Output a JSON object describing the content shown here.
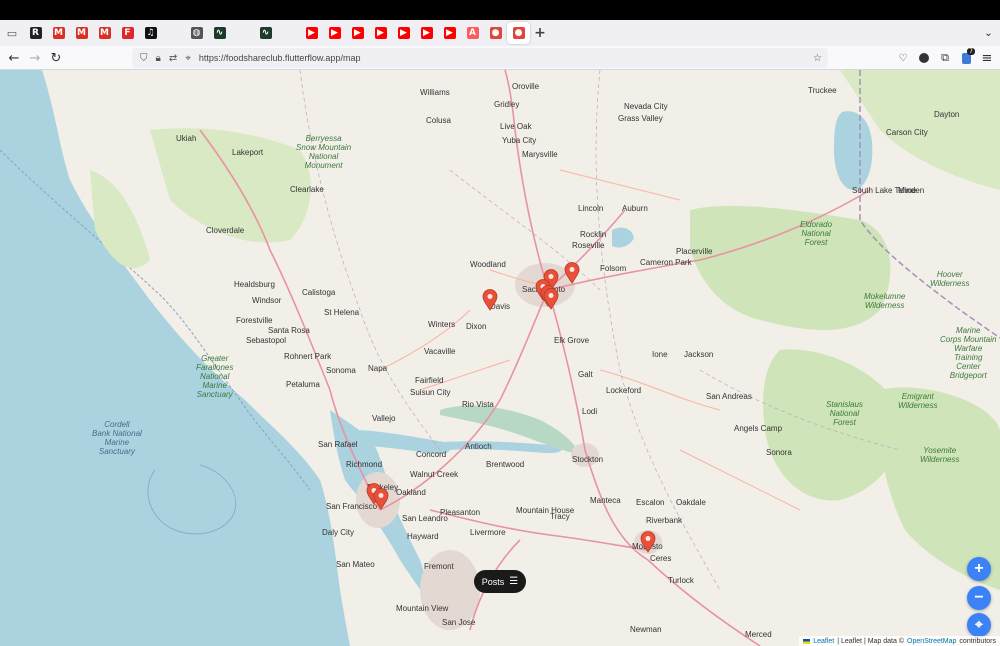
{
  "browser": {
    "url": "https://foodshareclub.flutterflow.app/map",
    "tabs": [
      {
        "icon": "r-icon",
        "color": "#222",
        "glyph": "R"
      },
      {
        "icon": "gmail-icon",
        "color": "#d93025",
        "glyph": "M"
      },
      {
        "icon": "gmail-icon",
        "color": "#d93025",
        "glyph": "M"
      },
      {
        "icon": "gmail-icon",
        "color": "#d93025",
        "glyph": "M"
      },
      {
        "icon": "flipboard-icon",
        "color": "#e12828",
        "glyph": "F"
      },
      {
        "icon": "spotify-icon",
        "color": "#111",
        "glyph": "♫"
      },
      {
        "icon": "blank-icon",
        "color": "#f0f0f4",
        "glyph": ""
      },
      {
        "icon": "globe-icon",
        "color": "#555",
        "glyph": "◍"
      },
      {
        "icon": "chart-icon",
        "color": "#1d3b2a",
        "glyph": "∿"
      },
      {
        "icon": "blank-icon",
        "color": "#f0f0f4",
        "glyph": ""
      },
      {
        "icon": "chart-icon",
        "color": "#1d3b2a",
        "glyph": "∿"
      },
      {
        "icon": "blank-icon",
        "color": "#f0f0f4",
        "glyph": ""
      },
      {
        "icon": "youtube-icon",
        "color": "#ff0000",
        "glyph": "▶"
      },
      {
        "icon": "youtube-icon",
        "color": "#ff0000",
        "glyph": "▶"
      },
      {
        "icon": "youtube-icon",
        "color": "#ff0000",
        "glyph": "▶"
      },
      {
        "icon": "youtube-icon",
        "color": "#ff0000",
        "glyph": "▶"
      },
      {
        "icon": "youtube-icon",
        "color": "#ff0000",
        "glyph": "▶"
      },
      {
        "icon": "youtube-icon",
        "color": "#ff0000",
        "glyph": "▶"
      },
      {
        "icon": "youtube-icon",
        "color": "#ff0000",
        "glyph": "▶"
      },
      {
        "icon": "airbnb-icon",
        "color": "#ff5a5f",
        "glyph": "A"
      },
      {
        "icon": "foodshare-icon",
        "color": "#e0463a",
        "glyph": "●"
      },
      {
        "icon": "foodshare-icon",
        "color": "#e0463a",
        "glyph": "●",
        "active": true
      }
    ],
    "extension_badge": "7"
  },
  "map": {
    "markers_color": "#e8503a",
    "labels": {
      "cities": [
        "Sacramento",
        "Woodland",
        "Davis",
        "Dixon",
        "Vacaville",
        "Fairfield",
        "Napa",
        "Sonoma",
        "Petaluma",
        "Santa Rosa",
        "San Rafael",
        "Berkeley",
        "San Francisco",
        "Daly City",
        "Oakland",
        "Hayward",
        "Fremont",
        "San Mateo",
        "Mountain View",
        "San Jose",
        "Concord",
        "Antioch",
        "Stockton",
        "Tracy",
        "Manteca",
        "Lodi",
        "Elk Grove",
        "Roseville",
        "Folsom",
        "Placerville",
        "Lincoln",
        "Yuba City",
        "Auburn",
        "Livermore",
        "Modesto",
        "Turlock",
        "Merced",
        "Newman",
        "Ukiah",
        "Lakeport",
        "Healdsburg",
        "Cloverdale",
        "Rio Vista",
        "Galt",
        "Jackson",
        "Sonora",
        "Escalon",
        "Oakdale",
        "Carson City",
        "Dayton",
        "Minden",
        "Grass Valley",
        "Nevada City",
        "Colusa",
        "Clearlake",
        "Calistoga",
        "St Helena",
        "Vallejo",
        "Richmond",
        "San Leandro",
        "Pleasanton",
        "Walnut Creek",
        "Brentwood",
        "Angels Camp",
        "San Andreas",
        "Truckee",
        "South Lake Tahoe",
        "Oroville",
        "Gridley",
        "Williams",
        "Cameron Park",
        "Rocklin",
        "Ione",
        "Lockeford",
        "Ceres",
        "Riverbank",
        "Mountain House",
        "Winters",
        "Suisun City",
        "Rohnert Park",
        "Sebastopol",
        "Forestville",
        "Windsor",
        "Marysville",
        "Live Oak"
      ],
      "parks": [
        "Berryessa\nSnow Mountain\nNational\nMonument",
        "Greater\nFarallones\nNational\nMarine\nSanctuary",
        "Eldorado\nNational\nForest",
        "Stanislaus\nNational\nForest",
        "Yosemite\nWilderness",
        "Emigrant\nWilderness",
        "Mokelumne\nWilderness",
        "Marine\nCorps Mountain\nWarfare\nTraining\nCenter\nBridgeport",
        "Hoover\nWilderness"
      ],
      "sea": [
        "Cordell\nBank National\nMarine\nSanctuary"
      ]
    }
  },
  "controls": {
    "posts_label": "Posts",
    "zoom_in": "+",
    "zoom_out": "−"
  },
  "attribution": {
    "leaflet1": "Leaflet",
    "sep": "| Leaflet | Map data ©",
    "osm": "OpenStreetMap",
    "contributors": "contributors"
  }
}
